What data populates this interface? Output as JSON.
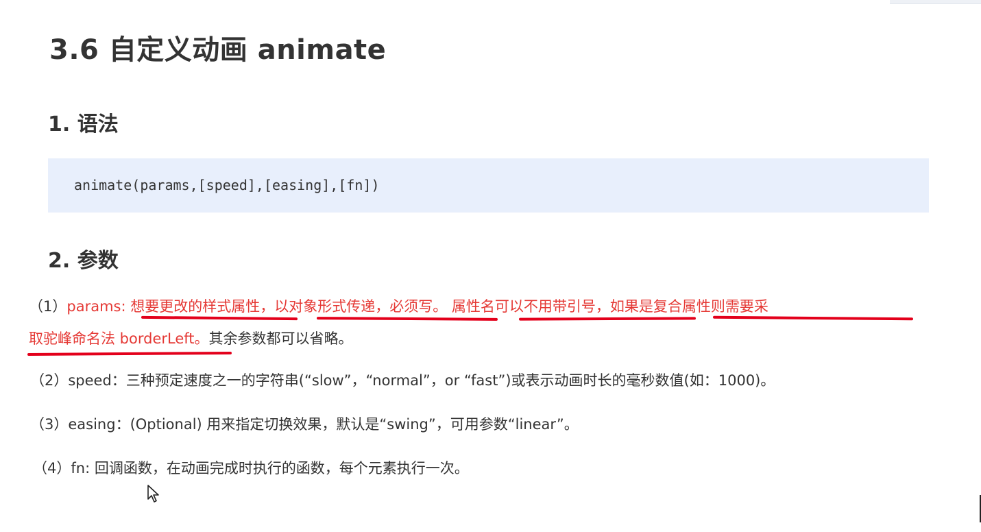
{
  "heading": {
    "title": "3.6  自定义动画 animate"
  },
  "sections": {
    "syntax": {
      "heading": "1. 语法",
      "code": "animate(params,[speed],[easing],[fn])"
    },
    "params": {
      "heading": "2. 参数",
      "p1": {
        "prefix": "（1）",
        "red_line1": "params: 想要更改的样式属性，以对象形式传递，必须写。 属性名可以不用带引号，如果是复合属性则需要采",
        "red_line2": "取驼峰命名法 borderLeft。",
        "rest": "其余参数都可以省略。"
      },
      "p2": "（2）speed：三种预定速度之一的字符串(“slow”，“normal”，or “fast”)或表示动画时长的毫秒数值(如：1000)。",
      "p3": "（3）easing：(Optional) 用来指定切换效果，默认是“swing”，可用参数“linear”。",
      "p4": "（4）fn: 回调函数，在动画完成时执行的函数，每个元素执行一次。"
    }
  },
  "colors": {
    "text": "#333333",
    "highlight_red": "#e53935",
    "underline_red": "#e3001b",
    "code_background": "#e8effc"
  },
  "icons": [
    "mouse-cursor-icon"
  ]
}
